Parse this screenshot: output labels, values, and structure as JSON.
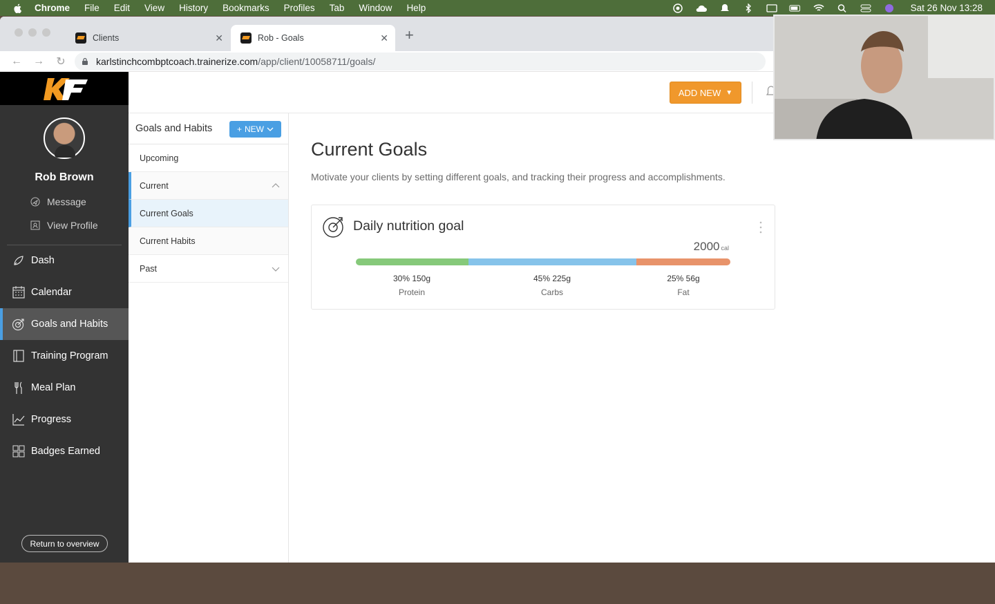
{
  "menubar": {
    "app": "Chrome",
    "items": [
      "File",
      "Edit",
      "View",
      "History",
      "Bookmarks",
      "Profiles",
      "Tab",
      "Window",
      "Help"
    ],
    "clock": "Sat 26 Nov  13:28"
  },
  "browser": {
    "tabs": [
      {
        "title": "Clients"
      },
      {
        "title": "Rob - Goals"
      }
    ],
    "url_host": "karlstinchcombptcoach.trainerize.com",
    "url_path": "/app/client/10058711/goals/"
  },
  "topbar": {
    "add_new_label": "ADD NEW"
  },
  "sidebar": {
    "client_name": "Rob Brown",
    "message_label": "Message",
    "view_profile_label": "View Profile",
    "nav": [
      {
        "label": "Dash",
        "icon": "rocket-icon"
      },
      {
        "label": "Calendar",
        "icon": "calendar-icon"
      },
      {
        "label": "Goals and Habits",
        "icon": "target-icon"
      },
      {
        "label": "Training Program",
        "icon": "book-icon"
      },
      {
        "label": "Meal Plan",
        "icon": "cutlery-icon"
      },
      {
        "label": "Progress",
        "icon": "chart-icon"
      },
      {
        "label": "Badges Earned",
        "icon": "grid-icon"
      }
    ],
    "return_label": "Return to overview",
    "accent": "#4a9fe3"
  },
  "subnav": {
    "title": "Goals and Habits",
    "new_label": "NEW",
    "items": [
      "Upcoming",
      "Current",
      "Current Goals",
      "Current Habits",
      "Past"
    ]
  },
  "main": {
    "title": "Current Goals",
    "description": "Motivate your clients by setting different goals, and tracking their progress and accomplishments.",
    "goal": {
      "title": "Daily nutrition goal",
      "calories": "2000",
      "unit": "cal",
      "macros": [
        {
          "value": "30% 150g",
          "label": "Protein",
          "percent": 30,
          "color": "#86c97a"
        },
        {
          "value": "45% 225g",
          "label": "Carbs",
          "percent": 45,
          "color": "#86c3ea"
        },
        {
          "value": "25% 56g",
          "label": "Fat",
          "percent": 25,
          "color": "#e8936a"
        }
      ]
    }
  }
}
